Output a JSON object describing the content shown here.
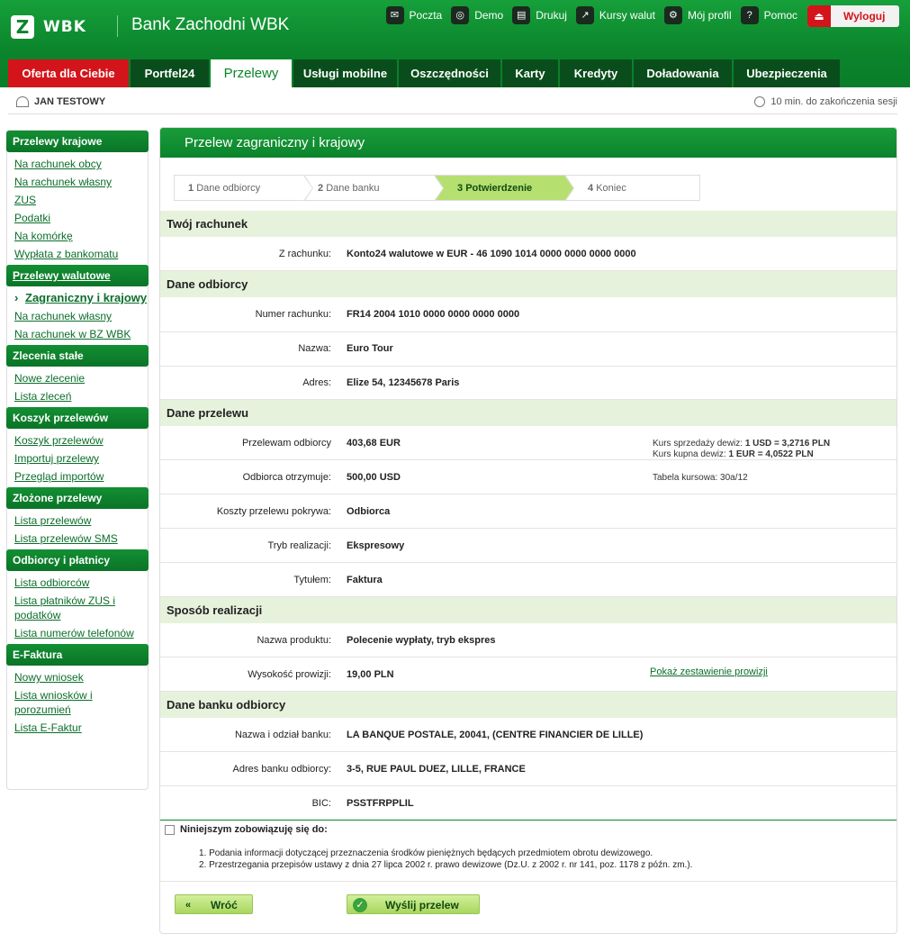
{
  "brand": {
    "logo_letter": "Z",
    "logo_word": "WBK",
    "bank_name": "Bank Zachodni WBK"
  },
  "toplinks": [
    {
      "label": "Poczta",
      "icon": "mail-icon"
    },
    {
      "label": "Demo",
      "icon": "demo-icon"
    },
    {
      "label": "Drukuj",
      "icon": "print-icon"
    },
    {
      "label": "Kursy walut",
      "icon": "chart-icon"
    },
    {
      "label": "Mój profil",
      "icon": "gear-icon"
    },
    {
      "label": "Pomoc",
      "icon": "help-icon"
    }
  ],
  "logout_label": "Wyloguj",
  "tabs": [
    {
      "label": "Oferta dla Ciebie"
    },
    {
      "label": "Portfel24"
    },
    {
      "label": "Przelewy"
    },
    {
      "label": "Usługi mobilne"
    },
    {
      "label": "Oszczędności"
    },
    {
      "label": "Karty"
    },
    {
      "label": "Kredyty"
    },
    {
      "label": "Doładowania"
    },
    {
      "label": "Ubezpieczenia"
    }
  ],
  "user_name": "JAN TESTOWY",
  "session_text": "10 min. do zakończenia sesji",
  "sidebar": [
    {
      "title": "Przelewy krajowe",
      "items": [
        "Na rachunek obcy",
        "Na rachunek własny",
        "ZUS",
        "Podatki",
        "Na komórkę",
        "Wypłata z bankomatu"
      ]
    },
    {
      "title": "Przelewy walutowe",
      "items": [
        "Zagraniczny i krajowy",
        "Na rachunek własny",
        "Na rachunek w BZ WBK"
      ]
    },
    {
      "title": "Zlecenia stałe",
      "items": [
        "Nowe zlecenie",
        "Lista zleceń"
      ]
    },
    {
      "title": "Koszyk przelewów",
      "items": [
        "Koszyk przelewów",
        "Importuj przelewy",
        "Przegląd importów"
      ]
    },
    {
      "title": "Złożone przelewy",
      "items": [
        "Lista przelewów",
        "Lista przelewów SMS"
      ]
    },
    {
      "title": "Odbiorcy i płatnicy",
      "items": [
        "Lista odbiorców",
        "Lista płatników ZUS i podatków",
        "Lista numerów telefonów"
      ]
    },
    {
      "title": "E-Faktura",
      "items": [
        "Nowy wniosek",
        "Lista wniosków i porozumień",
        "Lista E-Faktur"
      ]
    }
  ],
  "page_title": "Przelew zagraniczny i krajowy",
  "steps": [
    {
      "num": "1",
      "label": "Dane odbiorcy"
    },
    {
      "num": "2",
      "label": "Dane banku"
    },
    {
      "num": "3",
      "label": "Potwierdzenie"
    },
    {
      "num": "4",
      "label": "Koniec"
    }
  ],
  "sections": {
    "account": "Twój rachunek",
    "recipient": "Dane odbiorcy",
    "transfer": "Dane przelewu",
    "method": "Sposób realizacji",
    "bank": "Dane banku odbiorcy"
  },
  "fields": {
    "from_account": {
      "label": "Z rachunku:",
      "value": "Konto24 walutowe w EUR - 46 1090 1014 0000 0000 0000 0000"
    },
    "account_number": {
      "label": "Numer rachunku:",
      "value": "FR14 2004 1010 0000 0000 0000 0000"
    },
    "name": {
      "label": "Nazwa:",
      "value": "Euro Tour"
    },
    "address": {
      "label": "Adres:",
      "value": "Elize 54, 12345678 Paris"
    },
    "amount_sent": {
      "label": "Przelewam odbiorcy",
      "value": "403,68 EUR"
    },
    "amount_received": {
      "label": "Odbiorca otrzymuje:",
      "value": "500,00 USD"
    },
    "costs": {
      "label": "Koszty przelewu pokrywa:",
      "value": "Odbiorca"
    },
    "mode": {
      "label": "Tryb realizacji:",
      "value": "Ekspresowy"
    },
    "title": {
      "label": "Tytułem:",
      "value": "Faktura"
    },
    "product": {
      "label": "Nazwa produktu:",
      "value": "Polecenie wypłaty, tryb ekspres"
    },
    "commission": {
      "label": "Wysokość prowizji:",
      "value": "19,00 PLN"
    },
    "bank_name": {
      "label": "Nazwa i odział banku:",
      "value": "LA BANQUE POSTALE, 20041, (CENTRE FINANCIER DE LILLE)"
    },
    "bank_address": {
      "label": "Adres banku odbiorcy:",
      "value": "3-5, RUE PAUL DUEZ, LILLE, FRANCE"
    },
    "bic": {
      "label": "BIC:",
      "value": "PSSTFRPPLIL"
    }
  },
  "rates": {
    "sell_label": "Kurs sprzedaży dewiz:",
    "sell_value": "1 USD = 3,2716 PLN",
    "buy_label": "Kurs kupna dewiz:",
    "buy_value": "1 EUR = 4,0522 PLN",
    "table": "Tabela kursowa: 30a/12"
  },
  "commission_link": "Pokaż zestawienie prowizji",
  "declaration": {
    "title": "Niniejszym zobowiązuję się do:",
    "items": [
      "1.   Podania informacji dotyczącej przeznaczenia środków pieniężnych będących przedmiotem obrotu dewizowego.",
      "2.   Przestrzegania przepisów ustawy z dnia 27 lipca 2002 r. prawo dewizowe (Dz.U. z 2002 r. nr 141, poz. 1178 z późn. zm.)."
    ]
  },
  "buttons": {
    "back": "Wróć",
    "send": "Wyślij przelew"
  },
  "colors": {
    "brand_green": "#0b842c",
    "accent_red": "#d4141b",
    "section_bg": "#e7f2dc",
    "active_step": "#b5e070"
  }
}
